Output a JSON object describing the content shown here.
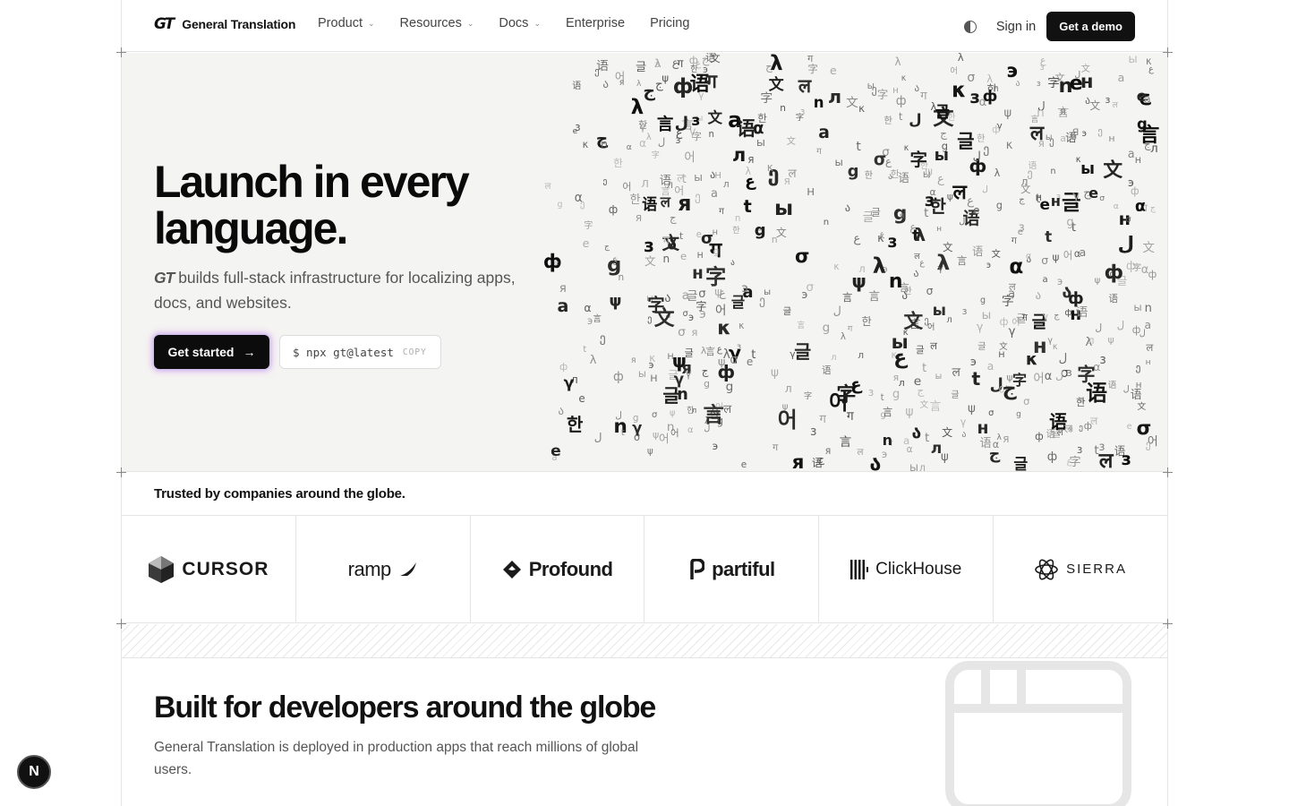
{
  "header": {
    "brand_mark": "GT",
    "brand_name": "General Translation",
    "nav": [
      {
        "label": "Product",
        "has_dropdown": true
      },
      {
        "label": "Resources",
        "has_dropdown": true
      },
      {
        "label": "Docs",
        "has_dropdown": true
      },
      {
        "label": "Enterprise",
        "has_dropdown": false
      },
      {
        "label": "Pricing",
        "has_dropdown": false
      }
    ],
    "theme_toggle_icon": "contrast-icon",
    "signin_label": "Sign in",
    "demo_label": "Get a demo"
  },
  "hero": {
    "title": "Launch in every language.",
    "subtitle_mark": "GT",
    "subtitle": "builds full-stack infrastructure for localizing apps, docs, and websites.",
    "start_label": "Get started",
    "start_icon": "arrow-right-icon",
    "command": "$ npx gt@latest",
    "copy_label": "COPY",
    "glyphs": [
      "文",
      "字",
      "语",
      "言",
      "α",
      "λ",
      "γ",
      "σ",
      "κ",
      "е",
      "ы",
      "я",
      "з",
      "л",
      "ф",
      "한",
      "어",
      "글",
      "g",
      "a",
      "t",
      "n",
      "ल",
      "ग",
      "ل",
      "ع",
      "ج",
      "ψ",
      "э",
      "н",
      "ა",
      "ე"
    ]
  },
  "trusted": {
    "heading": "Trusted by companies around the globe.",
    "logos": [
      {
        "name": "CURSOR",
        "icon": "cursor-cube-icon"
      },
      {
        "name": "ramp",
        "icon": "ramp-wing-icon"
      },
      {
        "name": "Profound",
        "icon": "profound-arrow-icon"
      },
      {
        "name": "partiful",
        "icon": "partiful-p-icon"
      },
      {
        "name": "ClickHouse",
        "icon": "clickhouse-bars-icon"
      },
      {
        "name": "SIERRA",
        "icon": "sierra-knot-icon"
      }
    ]
  },
  "developers": {
    "title": "Built for developers around the globe",
    "subtitle": "General Translation is deployed in production apps that reach millions of global users."
  },
  "dev_badge": "N",
  "colors": {
    "primary": "#111111",
    "hero_bg": "#f4f4f2",
    "border": "#e5e5e5",
    "muted_text": "#555555"
  }
}
